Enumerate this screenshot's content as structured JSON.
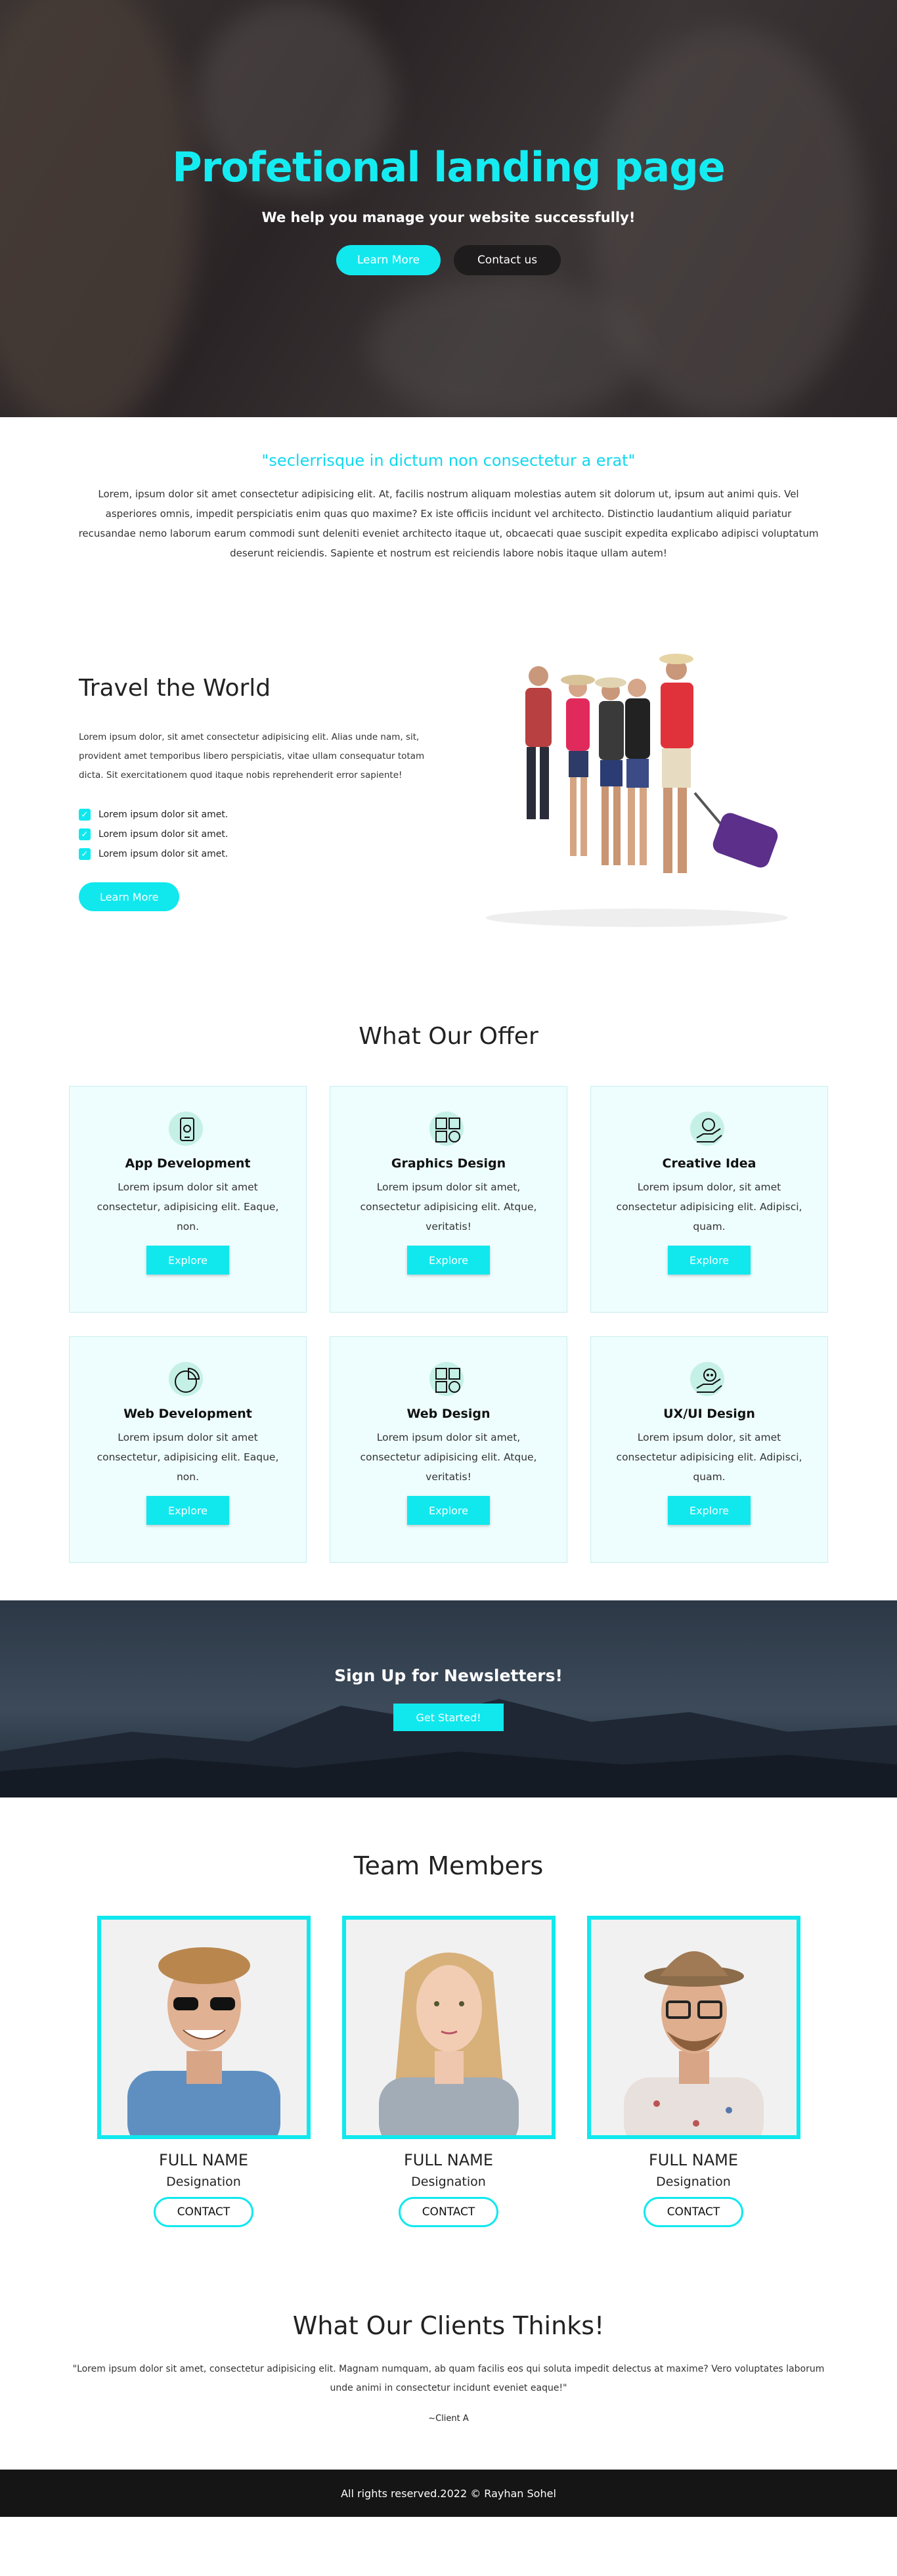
{
  "hero": {
    "title": "Profetional landing page",
    "subtitle": "We help you manage your website successfully!",
    "learn_more": "Learn More",
    "contact_us": "Contact us"
  },
  "intro": {
    "quote": "\"seclerrisque in dictum non consectetur a erat\"",
    "text": "Lorem, ipsum dolor sit amet consectetur adipisicing elit. At, facilis nostrum aliquam molestias autem sit dolorum ut, ipsum aut animi quis. Vel asperiores omnis, impedit perspiciatis enim quas quo maxime? Ex iste officiis incidunt vel architecto. Distinctio laudantium aliquid pariatur recusandae nemo laborum earum commodi sunt deleniti eveniet architecto itaque ut, obcaecati quae suscipit expedita explicabo adipisci voluptatum deserunt reiciendis. Sapiente et nostrum est reiciendis labore nobis itaque ullam autem!"
  },
  "travel": {
    "title": "Travel the World",
    "desc": "Lorem ipsum dolor, sit amet consectetur adipisicing elit. Alias unde nam, sit, provident amet temporibus libero perspiciatis, vitae ullam consequatur totam dicta. Sit exercitationem quod itaque nobis reprehenderit error sapiente!",
    "items": [
      "Lorem ipsum dolor sit amet.",
      "Lorem ipsum dolor sit amet.",
      "Lorem ipsum dolor sit amet."
    ],
    "button": "Learn More"
  },
  "offer": {
    "title": "What Our Offer",
    "cards": [
      {
        "title": "App Development",
        "text": "Lorem ipsum dolor sit amet consectetur, adipisicing elit. Eaque, non.",
        "button": "Explore",
        "icon": "mobile-app-icon"
      },
      {
        "title": "Graphics Design",
        "text": "Lorem ipsum dolor sit amet, consectetur adipisicing elit. Atque, veritatis!",
        "button": "Explore",
        "icon": "design-grid-icon"
      },
      {
        "title": "Creative Idea",
        "text": "Lorem ipsum dolor, sit amet consectetur adipisicing elit. Adipisci, quam.",
        "button": "Explore",
        "icon": "idea-hand-icon"
      },
      {
        "title": "Web Development",
        "text": "Lorem ipsum dolor sit amet consectetur, adipisicing elit. Eaque, non.",
        "button": "Explore",
        "icon": "pie-chart-icon"
      },
      {
        "title": "Web Design",
        "text": "Lorem ipsum dolor sit amet, consectetur adipisicing elit. Atque, veritatis!",
        "button": "Explore",
        "icon": "design-grid-icon"
      },
      {
        "title": "UX/UI Design",
        "text": "Lorem ipsum dolor, sit amet consectetur adipisicing elit. Adipisci, quam.",
        "button": "Explore",
        "icon": "chat-hand-icon"
      }
    ]
  },
  "newsletter": {
    "title": "Sign Up for Newsletters!",
    "button": "Get Started!"
  },
  "team": {
    "title": "Team Members",
    "members": [
      {
        "name": "FULL NAME",
        "designation": "Designation",
        "button": "CONTACT"
      },
      {
        "name": "FULL NAME",
        "designation": "Designation",
        "button": "CONTACT"
      },
      {
        "name": "FULL NAME",
        "designation": "Designation",
        "button": "CONTACT"
      }
    ]
  },
  "clients": {
    "title": "What Our Clients Thinks!",
    "quote": "\"Lorem ipsum dolor sit amet, consectetur adipisicing elit. Magnam numquam, ab quam facilis eos qui soluta impedit delectus at maxime? Vero voluptates laborum unde animi in consectetur incidunt eveniet eaque!\"",
    "client": "~Client A"
  },
  "footer": {
    "text": "All rights reserved.2022 © Rayhan Sohel"
  },
  "colors": {
    "accent": "#10e8ee",
    "title_cyan": "#15ecf2",
    "footer": "#151516",
    "card_bg": "#eefdfd"
  }
}
